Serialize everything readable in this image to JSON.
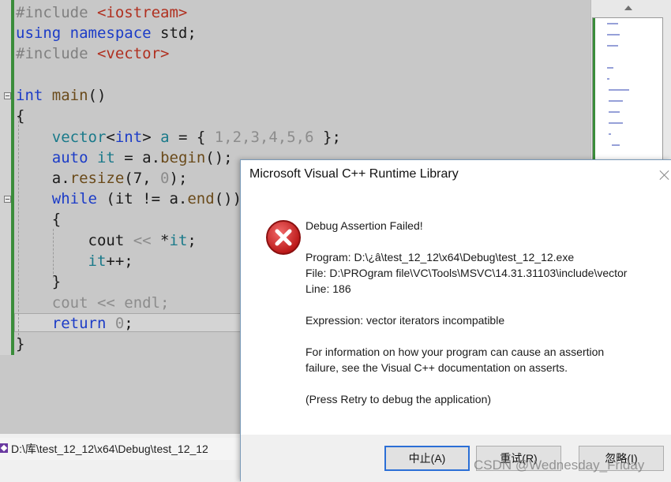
{
  "editor": {
    "lines": [
      {
        "segments": [
          {
            "t": "#include ",
            "c": "pp"
          },
          {
            "t": "<iostream>",
            "c": "str"
          }
        ]
      },
      {
        "segments": [
          {
            "t": "using namespace ",
            "c": "kw"
          },
          {
            "t": "std;",
            "c": "op"
          }
        ]
      },
      {
        "segments": [
          {
            "t": "#include ",
            "c": "pp"
          },
          {
            "t": "<vector>",
            "c": "str"
          }
        ]
      },
      {
        "segments": []
      },
      {
        "segments": [
          {
            "t": "int ",
            "c": "kw"
          },
          {
            "t": "main",
            "c": "fn"
          },
          {
            "t": "()",
            "c": "op"
          }
        ]
      },
      {
        "segments": [
          {
            "t": "{",
            "c": "op"
          }
        ]
      },
      {
        "segments": [
          {
            "t": "    ",
            "c": "op"
          },
          {
            "t": "vector",
            "c": "tp"
          },
          {
            "t": "<",
            "c": "op"
          },
          {
            "t": "int",
            "c": "kw"
          },
          {
            "t": "> ",
            "c": "op"
          },
          {
            "t": "a",
            "c": "tp"
          },
          {
            "t": " = { ",
            "c": "op"
          },
          {
            "t": "1,2,3,4,5,6",
            "c": "dim"
          },
          {
            "t": " };",
            "c": "op"
          }
        ]
      },
      {
        "segments": [
          {
            "t": "    ",
            "c": "op"
          },
          {
            "t": "auto ",
            "c": "kw"
          },
          {
            "t": "it",
            "c": "tp"
          },
          {
            "t": " = a.",
            "c": "op"
          },
          {
            "t": "begin",
            "c": "fn"
          },
          {
            "t": "();",
            "c": "op"
          }
        ]
      },
      {
        "segments": [
          {
            "t": "    a.",
            "c": "op"
          },
          {
            "t": "resize",
            "c": "fn"
          },
          {
            "t": "(7, ",
            "c": "op"
          },
          {
            "t": "0",
            "c": "dim"
          },
          {
            "t": ");",
            "c": "op"
          }
        ]
      },
      {
        "segments": [
          {
            "t": "    ",
            "c": "op"
          },
          {
            "t": "while ",
            "c": "kw"
          },
          {
            "t": "(it != a.",
            "c": "op"
          },
          {
            "t": "end",
            "c": "fn"
          },
          {
            "t": "())",
            "c": "op"
          }
        ]
      },
      {
        "segments": [
          {
            "t": "    {",
            "c": "op"
          }
        ]
      },
      {
        "segments": [
          {
            "t": "        cout ",
            "c": "op"
          },
          {
            "t": "<<",
            "c": "dim"
          },
          {
            "t": " *",
            "c": "op"
          },
          {
            "t": "it",
            "c": "tp"
          },
          {
            "t": ";",
            "c": "op"
          }
        ]
      },
      {
        "segments": [
          {
            "t": "        ",
            "c": "op"
          },
          {
            "t": "it",
            "c": "tp"
          },
          {
            "t": "++;",
            "c": "op"
          }
        ]
      },
      {
        "segments": [
          {
            "t": "    }",
            "c": "op"
          }
        ]
      },
      {
        "segments": [
          {
            "t": "    cout << endl;",
            "c": "dim"
          }
        ]
      },
      {
        "segments": [
          {
            "t": "    ",
            "c": "op"
          },
          {
            "t": "return ",
            "c": "kw"
          },
          {
            "t": "0",
            "c": "dim"
          },
          {
            "t": ";",
            "c": "op"
          }
        ]
      },
      {
        "segments": [
          {
            "t": "}",
            "c": "op"
          }
        ]
      }
    ]
  },
  "taskbar": {
    "path": "D:\\库\\test_12_12\\x64\\Debug\\test_12_12"
  },
  "dialog": {
    "title": "Microsoft Visual C++ Runtime Library",
    "heading": "Debug Assertion Failed!",
    "program": "Program: D:\\¿â\\test_12_12\\x64\\Debug\\test_12_12.exe",
    "file": "File: D:\\PROgram file\\VC\\Tools\\MSVC\\14.31.31103\\include\\vector",
    "line": "Line: 186",
    "expression": "Expression: vector iterators incompatible",
    "info_1": "For information on how your program can cause an assertion",
    "info_2": "failure, see the Visual C++ documentation on asserts.",
    "hint": "(Press Retry to debug the application)",
    "buttons": {
      "abort": "中止(A)",
      "retry": "重试(R)",
      "ignore": "忽略(I)"
    },
    "icon": "error-icon",
    "icon_color": "#d32626"
  },
  "watermark": "CSDN @Wednesday_Friday"
}
